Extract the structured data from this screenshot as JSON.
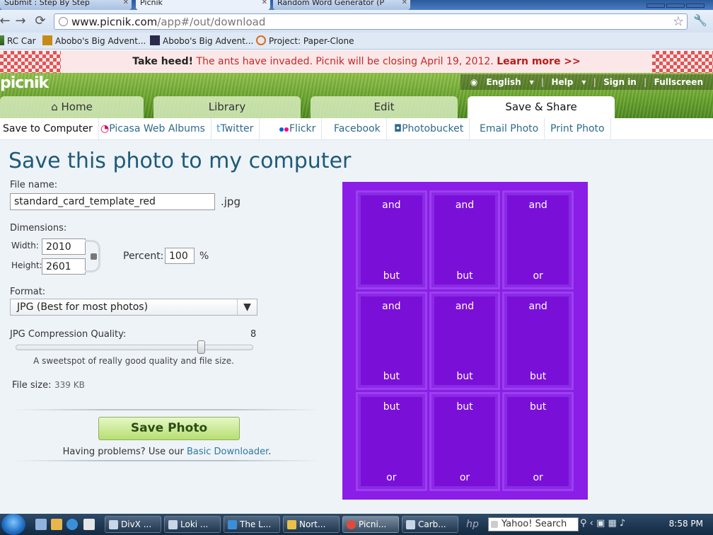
{
  "browser": {
    "tabs": [
      {
        "label": "Submit : Step By Step"
      },
      {
        "label": "Picnik"
      },
      {
        "label": "Random Word Generator (P"
      }
    ],
    "url_host": "www.picnik.com",
    "url_path": "/app#/out/download",
    "bookmarks": [
      {
        "label": "RC Car"
      },
      {
        "label": "Abobo's Big Advent..."
      },
      {
        "label": "Abobo's Big Advent..."
      },
      {
        "label": "Project: Paper-Clone"
      }
    ]
  },
  "notice": {
    "lead": "Take heed!",
    "message": "The ants have invaded. Picnik will be closing April 19, 2012.",
    "link": "Learn more >>"
  },
  "header": {
    "logo": "picnik",
    "links": [
      "English",
      "Help",
      "Sign in",
      "Fullscreen"
    ],
    "tabs": [
      {
        "label": "Home"
      },
      {
        "label": "Library"
      },
      {
        "label": "Edit"
      },
      {
        "label": "Save & Share"
      }
    ]
  },
  "subnav": [
    "Save to Computer",
    "Picasa Web Albums",
    "Twitter",
    "Flickr",
    "Facebook",
    "Photobucket",
    "Email Photo",
    "Print Photo"
  ],
  "form": {
    "title": "Save this photo to my computer",
    "file_name_label": "File name:",
    "file_name_value": "standard_card_template_red",
    "extension": ".jpg",
    "dimensions_label": "Dimensions:",
    "width_label": "Width:",
    "width_value": "2010",
    "height_label": "Height:",
    "height_value": "2601",
    "percent_label": "Percent:",
    "percent_value": "100",
    "percent_sign": "%",
    "format_label": "Format:",
    "format_value": "JPG  (Best for most photos)",
    "quality_label": "JPG Compression Quality:",
    "quality_value": "8",
    "quality_fraction": 0.78,
    "quality_hint": "A sweetspot of really good quality and file size.",
    "file_size_label": "File size:",
    "file_size_value": "339 KB",
    "save_button": "Save Photo",
    "problems_text": "Having problems? Use our",
    "problems_link": "Basic Downloader",
    "problems_end": "."
  },
  "preview": {
    "cards": [
      {
        "top": "and",
        "bottom": "but"
      },
      {
        "top": "and",
        "bottom": "but"
      },
      {
        "top": "and",
        "bottom": "or"
      },
      {
        "top": "and",
        "bottom": "but"
      },
      {
        "top": "and",
        "bottom": "but"
      },
      {
        "top": "and",
        "bottom": "but"
      },
      {
        "top": "but",
        "bottom": "or"
      },
      {
        "top": "but",
        "bottom": "or"
      },
      {
        "top": "but",
        "bottom": "or"
      }
    ]
  },
  "taskbar": {
    "tasks": [
      {
        "label": "DivX ..."
      },
      {
        "label": "Loki ..."
      },
      {
        "label": "The L..."
      },
      {
        "label": "Nort..."
      },
      {
        "label": "Picni..."
      },
      {
        "label": "Carb..."
      }
    ],
    "search_label": "Yahoo! Search",
    "clock": "8:58 PM"
  },
  "colors": {
    "title": "#1d5a7a",
    "preview_bg": "#8a1de6",
    "card_bg": "#7a10d8",
    "notice_red": "#c62828",
    "save_button": "#b7df72"
  }
}
